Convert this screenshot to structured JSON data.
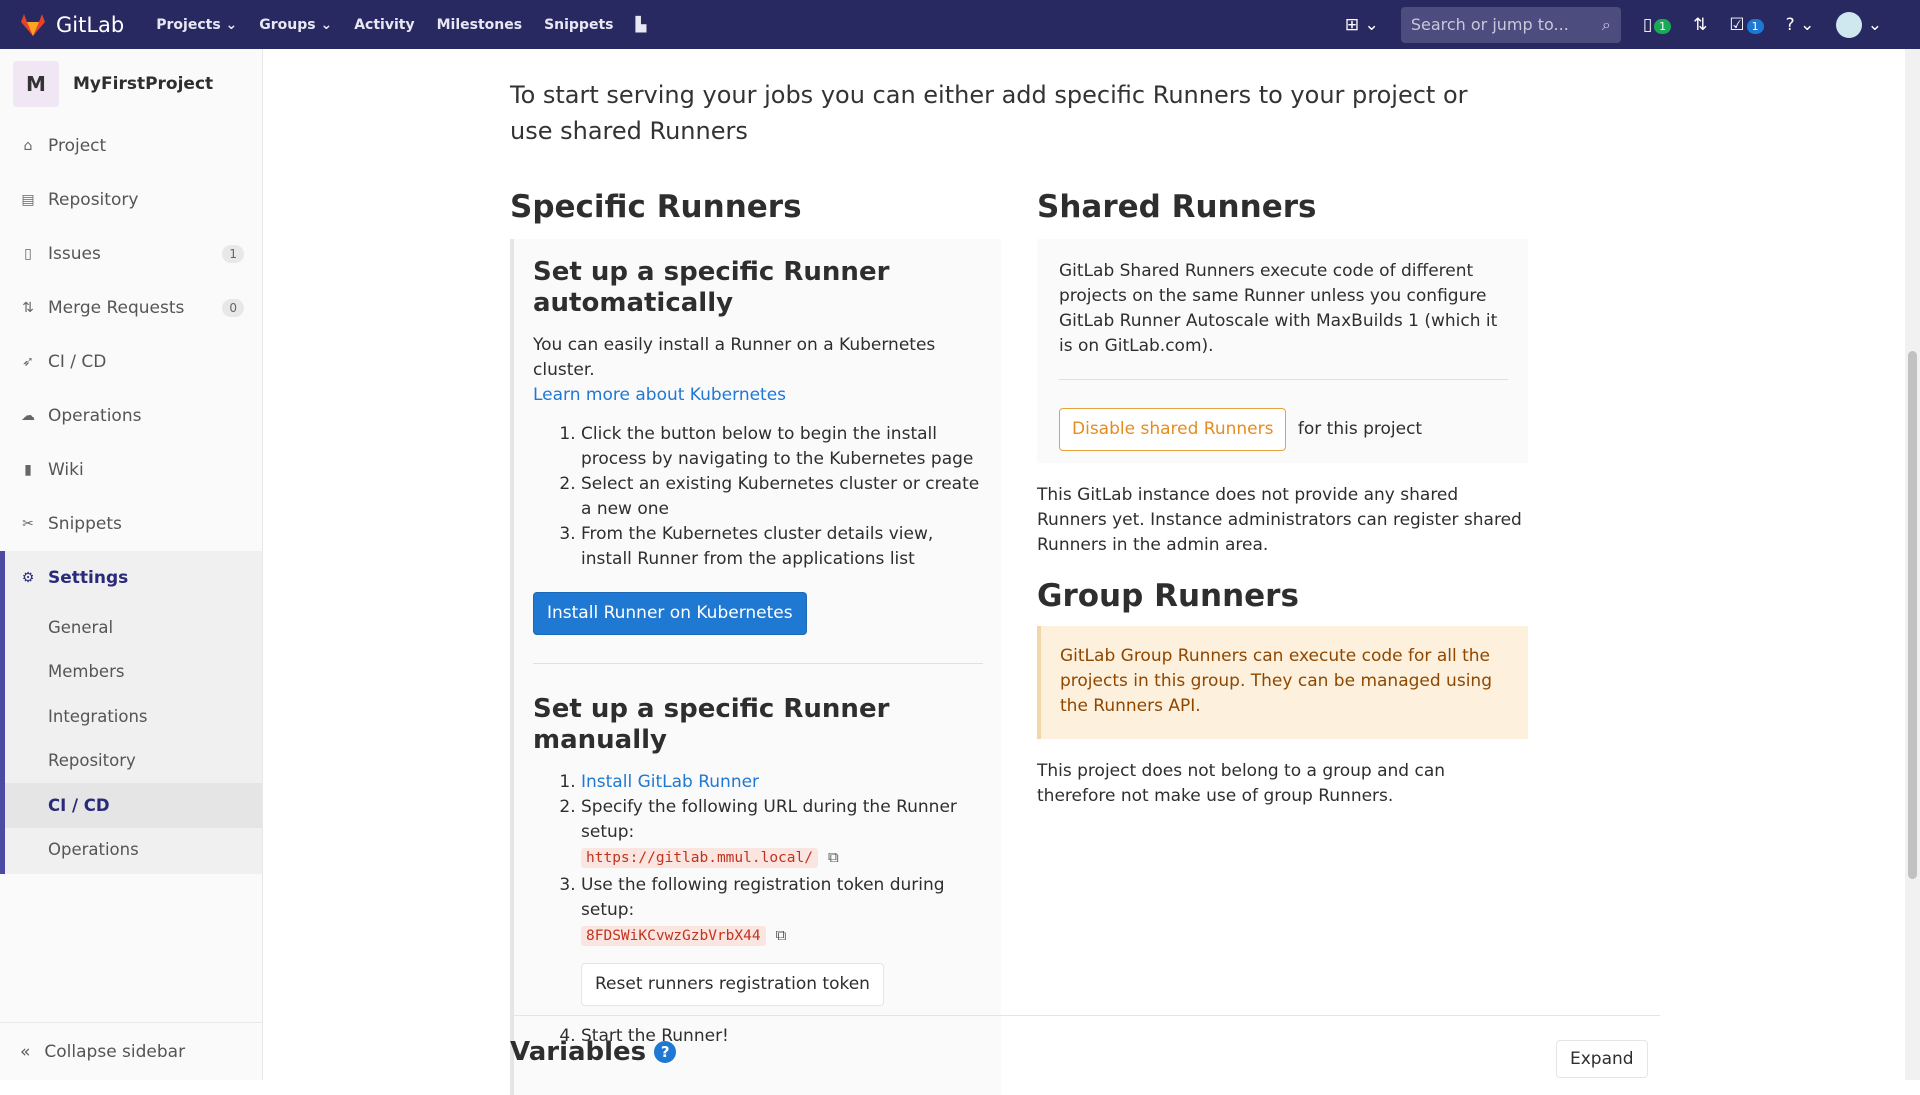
{
  "topbar": {
    "brand": "GitLab",
    "nav": [
      "Projects",
      "Groups",
      "Activity",
      "Milestones",
      "Snippets"
    ],
    "search_placeholder": "Search or jump to...",
    "issues_count": "1",
    "todos_count": "1"
  },
  "sidebar": {
    "project_initial": "M",
    "project_name": "MyFirstProject",
    "items": [
      {
        "label": "Project",
        "icon": "⌂"
      },
      {
        "label": "Repository",
        "icon": "▤"
      },
      {
        "label": "Issues",
        "icon": "▯",
        "count": "1"
      },
      {
        "label": "Merge Requests",
        "icon": "⇅",
        "count": "0"
      },
      {
        "label": "CI / CD",
        "icon": "➶"
      },
      {
        "label": "Operations",
        "icon": "☁"
      },
      {
        "label": "Wiki",
        "icon": "▮"
      },
      {
        "label": "Snippets",
        "icon": "✂"
      }
    ],
    "settings": {
      "label": "Settings",
      "sub": [
        "General",
        "Members",
        "Integrations",
        "Repository",
        "CI / CD",
        "Operations"
      ]
    },
    "collapse": "Collapse sidebar"
  },
  "main": {
    "intro": "To start serving your jobs you can either add specific Runners to your project or use shared Runners",
    "specific": {
      "title": "Specific Runners",
      "auto_title": "Set up a specific Runner automatically",
      "auto_text": "You can easily install a Runner on a Kubernetes cluster.",
      "auto_link": "Learn more about Kubernetes",
      "auto_steps": [
        "Click the button below to begin the install process by navigating to the Kubernetes page",
        "Select an existing Kubernetes cluster or create a new one",
        "From the Kubernetes cluster details view, install Runner from the applications list"
      ],
      "install_button": "Install Runner on Kubernetes",
      "manual_title": "Set up a specific Runner manually",
      "step1_link": "Install GitLab Runner",
      "step2": "Specify the following URL during the Runner setup:",
      "url": "https://gitlab.mmul.local/",
      "step3": "Use the following registration token during setup:",
      "token": "8FDSWiKCvwzGzbVrbX44",
      "reset_button": "Reset runners registration token",
      "step4": "Start the Runner!"
    },
    "shared": {
      "title": "Shared Runners",
      "text": "GitLab Shared Runners execute code of different projects on the same Runner unless you configure GitLab Runner Autoscale with MaxBuilds 1 (which it is on GitLab.com).",
      "disable_button": "Disable shared Runners",
      "suffix": "for this project",
      "note": "This GitLab instance does not provide any shared Runners yet. Instance administrators can register shared Runners in the admin area."
    },
    "group": {
      "title": "Group Runners",
      "warning": "GitLab Group Runners can execute code for all the projects in this group. They can be managed using the Runners API.",
      "note": "This project does not belong to a group and can therefore not make use of group Runners."
    },
    "variables": {
      "title": "Variables",
      "expand": "Expand"
    }
  }
}
